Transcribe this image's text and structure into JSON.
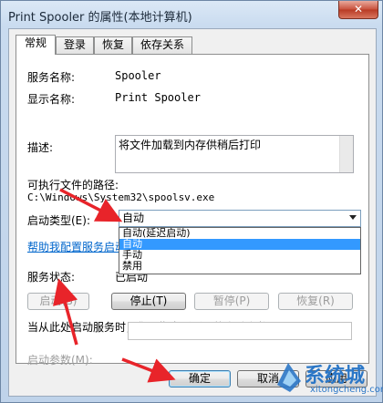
{
  "window": {
    "title": "Print Spooler 的属性(本地计算机)",
    "close_label": "✕"
  },
  "tabs": [
    {
      "label": "常规",
      "active": true
    },
    {
      "label": "登录",
      "active": false
    },
    {
      "label": "恢复",
      "active": false
    },
    {
      "label": "依存关系",
      "active": false
    }
  ],
  "general": {
    "service_name_label": "服务名称:",
    "service_name_value": "Spooler",
    "display_name_label": "显示名称:",
    "display_name_value": "Print Spooler",
    "description_label": "描述:",
    "description_value": "将文件加载到内存供稍后打印",
    "path_label": "可执行文件的路径:",
    "path_value": "C:\\Windows\\System32\\spoolsv.exe",
    "startup_type_label": "启动类型(E):",
    "startup_type_value": "自动",
    "startup_options": [
      "自动(延迟启动)",
      "自动",
      "手动",
      "禁用"
    ],
    "help_link": "帮助我配置服务启动",
    "status_label": "服务状态:",
    "status_value": "已启动",
    "start_button": "启动(S)",
    "stop_button": "停止(T)",
    "pause_button": "暂停(P)",
    "resume_button": "恢复(R)",
    "hint_text": "当从此处启动服务时，您可指定所适用的启动参数。",
    "params_label": "启动参数(M):",
    "params_value": ""
  },
  "footer": {
    "ok_button": "确定",
    "cancel_button": "取消",
    "apply_button": "应用"
  },
  "watermark": {
    "main": "系统城",
    "sub": "xitongcheng.com"
  },
  "colors": {
    "selection": "#3399ff",
    "link": "#0066cc",
    "annotation_arrow": "#e8242a",
    "watermark": "#2b77c7"
  }
}
